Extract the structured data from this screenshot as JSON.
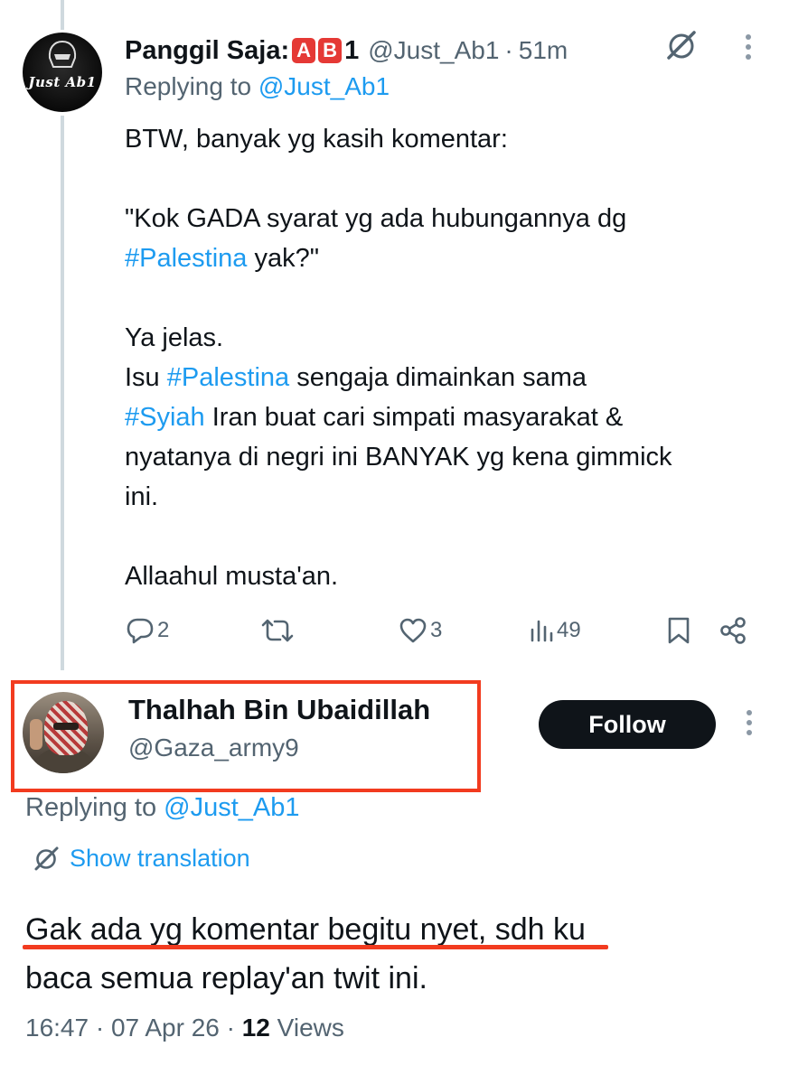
{
  "tweet1": {
    "author_name": "Panggil Saja:",
    "author_emoji_a": "A",
    "author_emoji_b": "B",
    "author_suffix": "1",
    "handle": "@Just_Ab1",
    "separator": "·",
    "time": "51m",
    "avatar_logo_text": "Just Ab1",
    "replying_to_label": "Replying to",
    "replying_to_handle": "@Just_Ab1",
    "body": {
      "line1": "BTW, banyak yg kasih komentar:",
      "line2": "\"Kok GADA syarat yg ada hubungannya dg",
      "line3_tag": "#Palestina",
      "line3_rest": " yak?\"",
      "line4": "Ya jelas.",
      "line5_pre": "Isu ",
      "line5_tag": "#Palestina",
      "line5_rest": " sengaja dimainkan sama",
      "line6_tag": "#Syiah",
      "line6_rest": " Iran buat cari simpati masyarakat &",
      "line7": "nyatanya di negri ini BANYAK yg kena gimmick",
      "line8": "ini.",
      "line9": "Allaahul musta'an."
    },
    "actions": {
      "replies": "2",
      "retweets": "",
      "likes": "3",
      "views": "49"
    }
  },
  "tweet2": {
    "author_name": "Thalhah Bin Ubaidillah",
    "handle": "@Gaza_army9",
    "follow_label": "Follow",
    "replying_to_label": "Replying to",
    "replying_to_handle": "@Just_Ab1",
    "show_translation": "Show translation",
    "body_line1": "Gak ada yg komentar begitu nyet, sdh ku",
    "body_line2": "baca semua replay'an twit ini.",
    "time": "16:47",
    "date": "07 Apr 26",
    "meta_sep": "·",
    "views_count": "12",
    "views_label": "Views"
  },
  "colors": {
    "accent": "#1d9bf0",
    "secondary_text": "#536471",
    "highlight_red": "#f23b1f",
    "follow_button": "#0f1419"
  }
}
